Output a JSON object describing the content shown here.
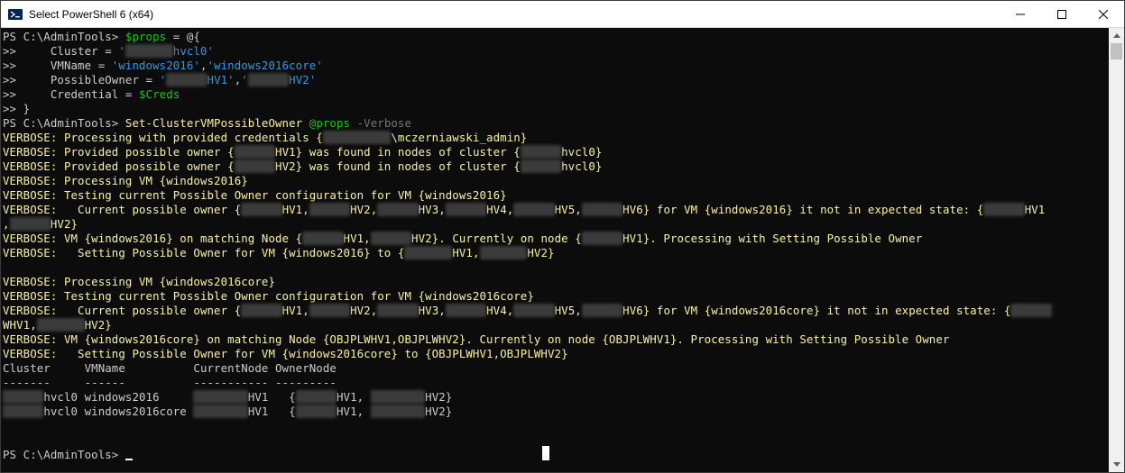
{
  "window": {
    "title": "Select PowerShell 6 (x64)",
    "controls": {
      "minimize": "minimize-icon",
      "maximize": "maximize-icon",
      "close": "close-icon"
    }
  },
  "colors": {
    "background": "#0c0c0c",
    "default_text": "#cccccc",
    "verbose": "#f9f1a5",
    "variable": "#16c60c",
    "string": "#3a96dd",
    "parameter": "#767676"
  },
  "console_lines": [
    [
      {
        "t": "PS C:\\AdminTools> ",
        "c": "w"
      },
      {
        "t": "$props",
        "c": "v"
      },
      {
        "t": " = @{",
        "c": "w"
      }
    ],
    [
      {
        "t": ">>     Cluster = ",
        "c": "w"
      },
      {
        "t": "'",
        "c": "s"
      },
      {
        "t": "XXXXXXX",
        "c": "m"
      },
      {
        "t": "hvcl0'",
        "c": "s"
      }
    ],
    [
      {
        "t": ">>     VMName = ",
        "c": "w"
      },
      {
        "t": "'windows2016'",
        "c": "s"
      },
      {
        "t": ",",
        "c": "w"
      },
      {
        "t": "'windows2016core'",
        "c": "s"
      }
    ],
    [
      {
        "t": ">>     PossibleOwner = ",
        "c": "w"
      },
      {
        "t": "'",
        "c": "s"
      },
      {
        "t": "XXXXXX",
        "c": "m"
      },
      {
        "t": "HV1'",
        "c": "s"
      },
      {
        "t": ",",
        "c": "w"
      },
      {
        "t": "'",
        "c": "s"
      },
      {
        "t": "XXXXXX",
        "c": "m"
      },
      {
        "t": "HV2'",
        "c": "s"
      }
    ],
    [
      {
        "t": ">>     Credential = ",
        "c": "w"
      },
      {
        "t": "$Creds",
        "c": "v"
      }
    ],
    [
      {
        "t": ">> }",
        "c": "w"
      }
    ],
    [
      {
        "t": "PS C:\\AdminTools> ",
        "c": "w"
      },
      {
        "t": "Set-ClusterVMPossibleOwner ",
        "c": "y"
      },
      {
        "t": "@props",
        "c": "v"
      },
      {
        "t": " -Verbose",
        "c": "g"
      }
    ],
    [
      {
        "t": "VERBOSE: Processing with provided credentials {",
        "c": "y"
      },
      {
        "t": "XXXXXXXXXX",
        "c": "m"
      },
      {
        "t": "\\mczerniawski_admin}",
        "c": "y"
      }
    ],
    [
      {
        "t": "VERBOSE: Provided possible owner {",
        "c": "y"
      },
      {
        "t": "XXXXXX",
        "c": "m"
      },
      {
        "t": "HV1} was found in nodes of cluster {",
        "c": "y"
      },
      {
        "t": "XXXXXX",
        "c": "m"
      },
      {
        "t": "hvcl0}",
        "c": "y"
      }
    ],
    [
      {
        "t": "VERBOSE: Provided possible owner {",
        "c": "y"
      },
      {
        "t": "XXXXXX",
        "c": "m"
      },
      {
        "t": "HV2} was found in nodes of cluster {",
        "c": "y"
      },
      {
        "t": "XXXXXX",
        "c": "m"
      },
      {
        "t": "hvcl0}",
        "c": "y"
      }
    ],
    [
      {
        "t": "VERBOSE: Processing VM {windows2016}",
        "c": "y"
      }
    ],
    [
      {
        "t": "VERBOSE: Testing current Possible Owner configuration for VM {windows2016}",
        "c": "y"
      }
    ],
    [
      {
        "t": "VERBOSE:   Current possible owner {",
        "c": "y"
      },
      {
        "t": "XXXXXX",
        "c": "m"
      },
      {
        "t": "HV1,",
        "c": "y"
      },
      {
        "t": "XXXXXX",
        "c": "m"
      },
      {
        "t": "HV2,",
        "c": "y"
      },
      {
        "t": "XXXXXX",
        "c": "m"
      },
      {
        "t": "HV3,",
        "c": "y"
      },
      {
        "t": "XXXXXX",
        "c": "m"
      },
      {
        "t": "HV4,",
        "c": "y"
      },
      {
        "t": "XXXXXX",
        "c": "m"
      },
      {
        "t": "HV5,",
        "c": "y"
      },
      {
        "t": "XXXXXX",
        "c": "m"
      },
      {
        "t": "HV6} for VM {windows2016} it not in expected state: {",
        "c": "y"
      },
      {
        "t": "XXXXXX",
        "c": "m"
      },
      {
        "t": "HV1",
        "c": "y"
      }
    ],
    [
      {
        "t": ",",
        "c": "y"
      },
      {
        "t": "XXXXXX",
        "c": "m"
      },
      {
        "t": "HV2}",
        "c": "y"
      }
    ],
    [
      {
        "t": "VERBOSE: VM {windows2016} on matching Node {",
        "c": "y"
      },
      {
        "t": "XXXXXX",
        "c": "m"
      },
      {
        "t": "HV1,",
        "c": "y"
      },
      {
        "t": "XXXXXX",
        "c": "m"
      },
      {
        "t": "HV2}. Currently on node {",
        "c": "y"
      },
      {
        "t": "XXXXXX",
        "c": "m"
      },
      {
        "t": "HV1}. Processing with Setting Possible Owner",
        "c": "y"
      }
    ],
    [
      {
        "t": "VERBOSE:   Setting Possible Owner for VM {windows2016} to {",
        "c": "y"
      },
      {
        "t": "XXXXXXX",
        "c": "m"
      },
      {
        "t": "HV1,",
        "c": "y"
      },
      {
        "t": "XXXXXXX",
        "c": "m"
      },
      {
        "t": "HV2}",
        "c": "y"
      }
    ],
    [
      {
        "t": "",
        "c": "w"
      }
    ],
    [
      {
        "t": "VERBOSE: Processing VM {windows2016core}",
        "c": "y"
      }
    ],
    [
      {
        "t": "VERBOSE: Testing current Possible Owner configuration for VM {windows2016core}",
        "c": "y"
      }
    ],
    [
      {
        "t": "VERBOSE:   Current possible owner {",
        "c": "y"
      },
      {
        "t": "XXXXXX",
        "c": "m"
      },
      {
        "t": "HV1,",
        "c": "y"
      },
      {
        "t": "XXXXXX",
        "c": "m"
      },
      {
        "t": "HV2,",
        "c": "y"
      },
      {
        "t": "XXXXXX",
        "c": "m"
      },
      {
        "t": "HV3,",
        "c": "y"
      },
      {
        "t": "XXXXXX",
        "c": "m"
      },
      {
        "t": "HV4,",
        "c": "y"
      },
      {
        "t": "XXXXXX",
        "c": "m"
      },
      {
        "t": "HV5,",
        "c": "y"
      },
      {
        "t": "XXXXXX",
        "c": "m"
      },
      {
        "t": "HV6} for VM {windows2016core} it not in expected state: {",
        "c": "y"
      },
      {
        "t": "XXXXXX",
        "c": "m"
      }
    ],
    [
      {
        "t": "WHV1,",
        "c": "y"
      },
      {
        "t": "XXXXXXX",
        "c": "m"
      },
      {
        "t": "HV2}",
        "c": "y"
      }
    ],
    [
      {
        "t": "VERBOSE: VM {windows2016core} on matching Node {OBJPLWHV1,OBJPLWHV2}. Currently on node {OBJPLWHV1}. Processing with Setting Possible Owner",
        "c": "y"
      }
    ],
    [
      {
        "t": "VERBOSE:   Setting Possible Owner for VM {windows2016core} to {OBJPLWHV1,OBJPLWHV2}",
        "c": "y"
      }
    ],
    [
      {
        "t": "Cluster     VMName          CurrentNode OwnerNode",
        "c": "r"
      }
    ],
    [
      {
        "t": "-------     ------          ----------- ---------",
        "c": "r"
      }
    ],
    [
      {
        "t": "XXXXXX",
        "c": "m"
      },
      {
        "t": "hvcl0 windows2016     ",
        "c": "r"
      },
      {
        "t": "XXXXXXXX",
        "c": "m"
      },
      {
        "t": "HV1   {",
        "c": "r"
      },
      {
        "t": "XXXXXX",
        "c": "m"
      },
      {
        "t": "HV1, ",
        "c": "r"
      },
      {
        "t": "XXXXXXXX",
        "c": "m"
      },
      {
        "t": "HV2}",
        "c": "r"
      }
    ],
    [
      {
        "t": "XXXXXX",
        "c": "m"
      },
      {
        "t": "hvcl0 windows2016core ",
        "c": "r"
      },
      {
        "t": "XXXXXXXX",
        "c": "m"
      },
      {
        "t": "HV1   {",
        "c": "r"
      },
      {
        "t": "XXXXXX",
        "c": "m"
      },
      {
        "t": "HV1, ",
        "c": "r"
      },
      {
        "t": "XXXXXXXX",
        "c": "m"
      },
      {
        "t": "HV2}",
        "c": "r"
      }
    ],
    [
      {
        "t": "",
        "c": "w"
      }
    ],
    [
      {
        "t": "",
        "c": "w"
      }
    ],
    [
      {
        "t": "PS C:\\AdminTools> ",
        "c": "w"
      }
    ]
  ]
}
